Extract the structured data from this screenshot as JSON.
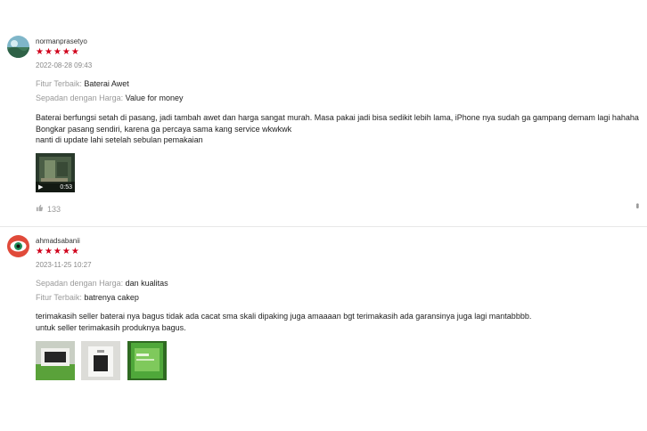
{
  "reviews": [
    {
      "username": "normanprasetyo",
      "stars": "★★★★★",
      "date": "2022-08-28 09:43",
      "attrs": [
        {
          "key": "Fitur Terbaik:",
          "value": "Baterai Awet"
        },
        {
          "key": "Sepadan dengan Harga:",
          "value": "Value for money"
        }
      ],
      "body_lines": [
        "Baterai berfungsi setah di pasang, jadi tambah awet dan harga sangat murah. Masa pakai jadi bisa sedikit lebih lama, iPhone nya sudah ga gampang demam lagi hahaha",
        "Bongkar pasang sendiri, karena ga percaya sama kang service wkwkwk",
        "nanti di update lahi setelah sebulan pemakaian"
      ],
      "video_duration": "0:53",
      "likes": "133",
      "more_icon": "more-vertical-icon"
    },
    {
      "username": "ahmadsabanii",
      "stars": "★★★★★",
      "date": "2023-11-25 10:27",
      "attrs": [
        {
          "key": "Sepadan dengan Harga:",
          "value": "dan kualitas"
        },
        {
          "key": "Fitur Terbaik:",
          "value": "batrenya cakep"
        }
      ],
      "body_lines": [
        "terimakasih seller baterai nya bagus tidak ada cacat sma skali dipaking juga amaaaan bgt terimakasih ada garansinya juga lagi mantabbbb.",
        "untuk seller terimakasih produknya bagus."
      ]
    }
  ],
  "colors": {
    "star": "#d0011b",
    "muted": "#9a9a9a",
    "divider": "#e8e8e8"
  }
}
